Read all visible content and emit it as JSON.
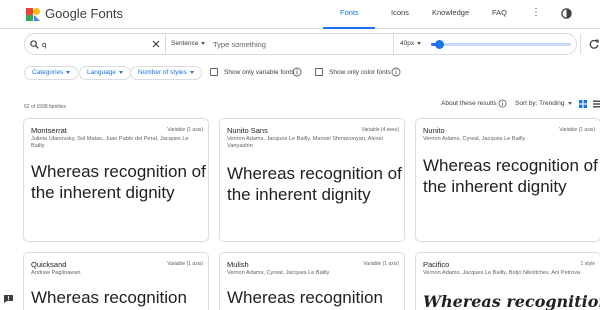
{
  "header": {
    "brand": "Google Fonts",
    "nav": [
      "Fonts",
      "Icons",
      "Knowledge",
      "FAQ"
    ],
    "active_nav": "Fonts"
  },
  "search": {
    "query": "q",
    "sentence_mode": "Sentence",
    "type_placeholder": "Type something",
    "font_size": "40px",
    "font_size_level": 0.06
  },
  "filters": {
    "categories": "Categories",
    "language": "Language",
    "styles": "Number of styles",
    "variable_only": "Show only variable fonts",
    "color_only": "Show only color fonts"
  },
  "results": {
    "count": "62 of 1508 families",
    "about": "About these results",
    "sort": "Sort by: Trending"
  },
  "fonts": [
    {
      "name": "Montserrat",
      "variable": "Variable (1 axis)",
      "authors": "Julieta Ulanovsky, Sol Matas, Juan Pablo del Peral, Jacques Le Bailly",
      "sample": "Whereas recognition of the inherent dignity"
    },
    {
      "name": "Nunito Sans",
      "variable": "Variable (4 axes)",
      "authors": "Vernon Adams, Jacques Le Bailly, Manvel Shmavonyan, Alexei Vanyashin",
      "sample": "Whereas recognition of the inherent dignity"
    },
    {
      "name": "Nunito",
      "variable": "Variable (1 axis)",
      "authors": "Vernon Adams, Cyreal, Jacques Le Bailly",
      "sample": "Whereas recognition of the inherent dignity"
    },
    {
      "name": "Quicksand",
      "variable": "Variable (1 axis)",
      "authors": "Andrew Paglinawan",
      "sample": "Whereas recognition"
    },
    {
      "name": "Mulish",
      "variable": "Variable (1 axis)",
      "authors": "Vernon Adams, Cyreal, Jacques Le Bailly",
      "sample": "Whereas recognition"
    },
    {
      "name": "Pacifico",
      "variable": "1 style",
      "authors": "Vernon Adams, Jacques Le Bailly, Botjo Nikoltchev, Ani Petrova",
      "sample": "Whereas recognition of"
    }
  ],
  "colors": {
    "accent": "#1a73e8",
    "border": "#dadce0",
    "muted_text": "#5f6368"
  },
  "icons": [
    "google-fonts-logo",
    "more-vert-icon",
    "theme-toggle-icon",
    "search-icon",
    "close-icon",
    "reset-icon",
    "info-icon",
    "grid-view-icon",
    "list-view-icon",
    "feedback-icon"
  ]
}
